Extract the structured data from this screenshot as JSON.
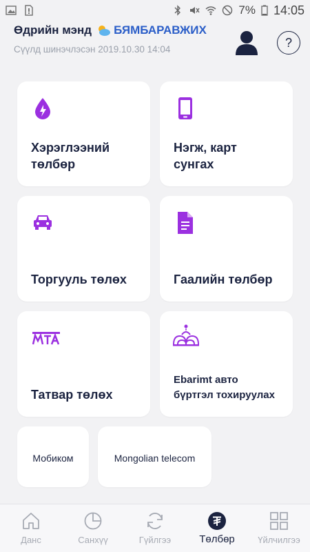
{
  "status_bar": {
    "battery": "7%",
    "time": "14:05"
  },
  "header": {
    "greeting": "Өдрийн мэнд",
    "username": "БЯМБАРАВЖИХ",
    "last_updated": "Сүүлд шинэчлэсэн 2019.10.30 14:04",
    "help_symbol": "?"
  },
  "cards": [
    {
      "label": "Хэрэглээний\nтөлбөр",
      "icon": "water-drop-bolt-icon"
    },
    {
      "label": "Нэгж, карт\nсунгах",
      "icon": "smartphone-icon"
    },
    {
      "label": "Торгууль төлөх",
      "icon": "car-icon"
    },
    {
      "label": "Гаалийн төлбөр",
      "icon": "document-icon"
    },
    {
      "label": "Татвар төлөх",
      "icon": "mta-logo-icon"
    },
    {
      "label": "Ebarimt авто\nбүртгэл тохируулах",
      "icon": "ebarimt-logo-icon"
    }
  ],
  "mini_cards": [
    {
      "label": "Мобиком"
    },
    {
      "label": "Mongolian telecom"
    }
  ],
  "nav": [
    {
      "label": "Данс",
      "icon": "home-icon",
      "active": false
    },
    {
      "label": "Санхүү",
      "icon": "pie-chart-icon",
      "active": false
    },
    {
      "label": "Гүйлгээ",
      "icon": "refresh-icon",
      "active": false
    },
    {
      "label": "Төлбөр",
      "icon": "tugrik-icon",
      "active": true
    },
    {
      "label": "Үйлчилгээ",
      "icon": "grid-icon",
      "active": false
    }
  ],
  "colors": {
    "accent": "#9b30e0",
    "text_dark": "#1b2340",
    "username_blue": "#2b5ec8",
    "background": "#f2f2f4"
  }
}
